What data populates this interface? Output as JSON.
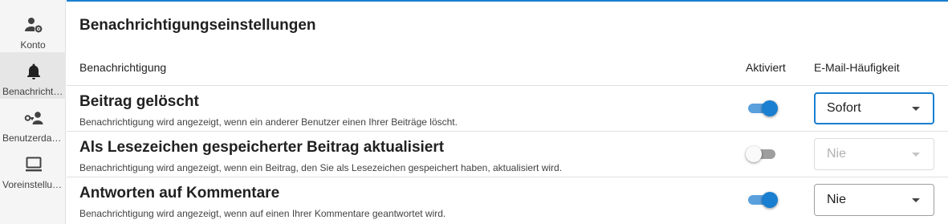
{
  "sidebar": {
    "items": [
      {
        "label": "Konto",
        "icon": "account-settings-icon"
      },
      {
        "label": "Benachrichtigungen",
        "icon": "bell-icon"
      },
      {
        "label": "Benutzerdaten",
        "icon": "user-key-icon"
      },
      {
        "label": "Voreinstellungen",
        "icon": "monitor-icon"
      }
    ],
    "active_index": 1
  },
  "main": {
    "title": "Benachrichtigungseinstellungen",
    "headers": {
      "notification": "Benachrichtigung",
      "enabled": "Aktiviert",
      "frequency": "E-Mail-Häufigkeit"
    },
    "rows": [
      {
        "title": "Beitrag gelöscht",
        "description": "Benachrichtigung wird angezeigt, wenn ein anderer Benutzer einen Ihrer Beiträge löscht.",
        "enabled": true,
        "frequency": "Sofort"
      },
      {
        "title": "Als Lesezeichen gespeicherter Beitrag aktualisiert",
        "description": "Benachrichtigung wird angezeigt, wenn ein Beitrag, den Sie als Lesezeichen gespeichert haben, aktualisiert wird.",
        "enabled": false,
        "frequency": "Nie"
      },
      {
        "title": "Antworten auf Kommentare",
        "description": "Benachrichtigung wird angezeigt, wenn auf einen Ihrer Kommentare geantwortet wird.",
        "enabled": true,
        "frequency": "Nie"
      }
    ]
  },
  "colors": {
    "accent": "#1a7fd0",
    "accent_track": "#5aa0dd",
    "sidebar_bg": "#f5f5f5",
    "divider": "#e0e0e0"
  }
}
